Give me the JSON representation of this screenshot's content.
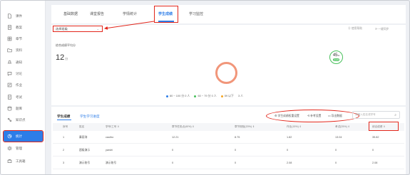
{
  "sidebar": {
    "items": [
      {
        "label": "课件",
        "icon": "file-icon",
        "active": false
      },
      {
        "label": "教案",
        "icon": "notebook-icon",
        "active": false
      },
      {
        "label": "章节",
        "icon": "grid-icon",
        "active": false
      },
      {
        "label": "资料",
        "icon": "folder-icon",
        "active": false
      },
      {
        "label": "通知",
        "icon": "bell-icon",
        "active": false
      },
      {
        "label": "讨论",
        "icon": "chat-icon",
        "active": false
      },
      {
        "label": "作业",
        "icon": "edit-icon",
        "active": false
      },
      {
        "label": "考试",
        "icon": "exam-icon",
        "active": false
      },
      {
        "label": "题库",
        "icon": "database-icon",
        "active": false
      },
      {
        "label": "知识点",
        "icon": "knowledge-icon",
        "active": false
      },
      {
        "label": "统计",
        "icon": "chart-icon",
        "active": true
      },
      {
        "label": "管理",
        "icon": "gear-icon",
        "active": false
      },
      {
        "label": "工具箱",
        "icon": "toolbox-icon",
        "active": false
      }
    ]
  },
  "tabs": [
    {
      "label": "基础数据",
      "active": false
    },
    {
      "label": "课堂报告",
      "active": false
    },
    {
      "label": "学情统计",
      "active": false
    },
    {
      "label": "学生成绩",
      "active": true
    },
    {
      "label": "学习监控",
      "active": false
    }
  ],
  "filter": {
    "selected": "选择班级"
  },
  "top_actions": {
    "help": "⓪ 使用帮助",
    "refresh": "⟳ 一键同步"
  },
  "summary": {
    "avg_label": "综合成绩平均分",
    "avg_value": "12",
    "avg_unit": "分",
    "badge_value": "45",
    "badge_unit": "%",
    "badge_sub": "及格率"
  },
  "legend": [
    {
      "label": "80 ~ 100 分 0 人",
      "color": "#2d7de8"
    },
    {
      "label": "60 ~ 79 分 0 人",
      "color": "#48c05b"
    },
    {
      "label": "59 以下",
      "color": "#f5a623"
    },
    {
      "label": "3 人",
      "color": ""
    }
  ],
  "scores": {
    "tabs": [
      {
        "label": "学生成绩",
        "active": true
      },
      {
        "label": "学生学习进度",
        "active": false
      }
    ],
    "tools": {
      "weight": "⚙ 学生成绩权重设置",
      "retake": "⟲ 补考设置",
      "export": "▭ 导出数据"
    },
    "search_placeholder": "请输入姓名或学号",
    "columns": [
      "序号",
      "姓名",
      "学号/工号 ⇕",
      "章节任务点(40%) ⇕",
      "章节测验(20%) ⇕",
      "作业(15%) ⇕",
      "考试(25%) ⇕",
      "综合成绩 ⇕"
    ],
    "rows": [
      [
        "1",
        "秦丽涛",
        "cauibo",
        "12.21",
        "8.75",
        "1.82",
        "13.04",
        "35.82"
      ],
      [
        "2",
        "超级演示",
        "yarshi",
        "0",
        "0",
        "0",
        "0",
        "0"
      ],
      [
        "3",
        "演示账号",
        "演示账号",
        "0",
        "0",
        "2.08",
        "0",
        "2.08"
      ]
    ]
  },
  "colors": {
    "accent": "#2d7de8",
    "highlight": "#e2261b",
    "donut": "#f1967a",
    "pass": "#48c05b"
  }
}
